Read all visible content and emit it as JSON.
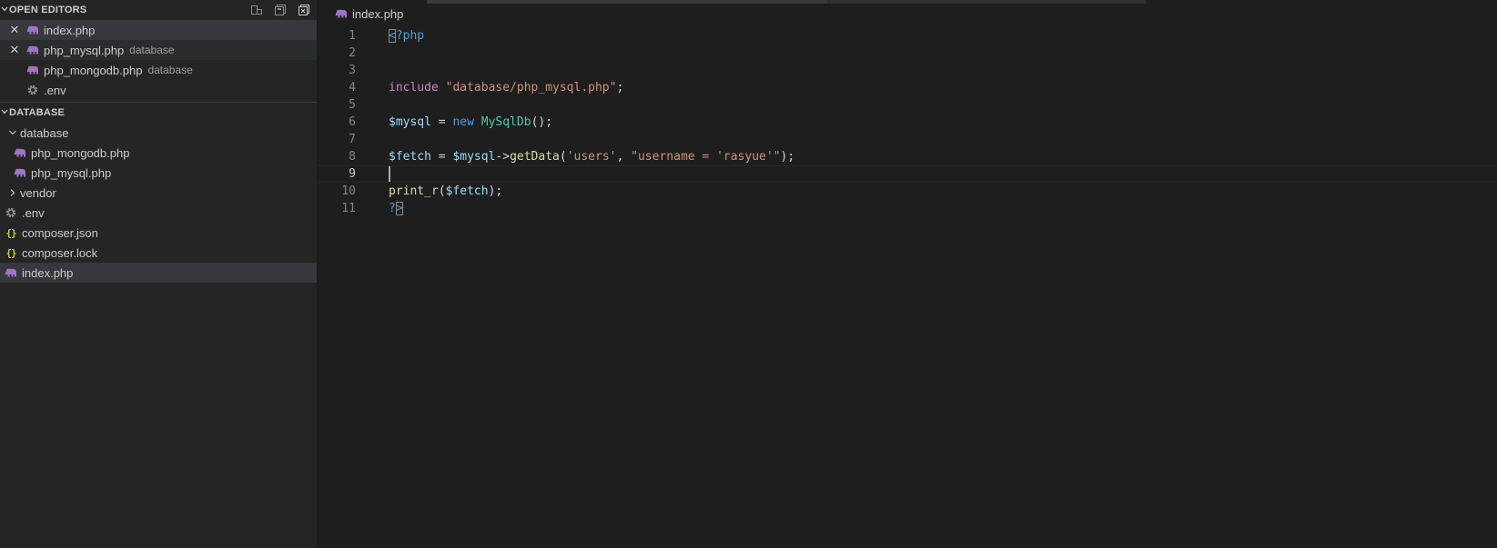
{
  "sidebar": {
    "open_editors": {
      "title": "OPEN EDITORS",
      "items": [
        {
          "name": "index.php",
          "desc": "",
          "has_close": true,
          "icon": "php-elephant-icon"
        },
        {
          "name": "php_mysql.php",
          "desc": "database",
          "has_close": true,
          "icon": "php-elephant-icon"
        },
        {
          "name": "php_mongodb.php",
          "desc": "database",
          "has_close": false,
          "icon": "php-elephant-icon"
        },
        {
          "name": ".env",
          "desc": "",
          "has_close": false,
          "icon": "gear-icon"
        }
      ]
    },
    "explorer": {
      "title": "DATABASE",
      "items": [
        {
          "name": "database",
          "type": "folder-open"
        },
        {
          "name": "php_mongodb.php",
          "type": "php-file"
        },
        {
          "name": "php_mysql.php",
          "type": "php-file"
        },
        {
          "name": "vendor",
          "type": "folder-closed"
        },
        {
          "name": ".env",
          "type": "env-file"
        },
        {
          "name": "composer.json",
          "type": "json-file"
        },
        {
          "name": "composer.lock",
          "type": "json-file"
        },
        {
          "name": "index.php",
          "type": "php-file"
        }
      ]
    }
  },
  "editor": {
    "tab_label": "index.php",
    "line_numbers": [
      "1",
      "2",
      "3",
      "4",
      "5",
      "6",
      "7",
      "8",
      "9",
      "10",
      "11"
    ],
    "code": {
      "l1_open": "<",
      "l1_rest": "?php",
      "l4_include": "include",
      "l4_str": "\"database/php_mysql.php\"",
      "l4_end": ";",
      "l6_var": "$mysql",
      "l6_eq": " = ",
      "l6_new": "new",
      "l6_class": "MySqlDb",
      "l6_end": "();",
      "l8_var": "$fetch",
      "l8_eq": " = ",
      "l8_obj": "$mysql",
      "l8_arrow": "->",
      "l8_fn": "getData",
      "l8_open": "(",
      "l8_str1": "'users'",
      "l8_comma": ", ",
      "l8_str2": "\"username = 'rasyue'\"",
      "l8_end": ");",
      "l10_fn": "print_r",
      "l10_open": "(",
      "l10_var": "$fetch",
      "l10_end": ");",
      "l11_q": "?",
      "l11_close": ">"
    }
  },
  "colors": {
    "php_icon": "#a074c4",
    "json_icon": "#cbcb41",
    "sidebar_bg": "#252526",
    "editor_bg": "#1e1e1e"
  }
}
